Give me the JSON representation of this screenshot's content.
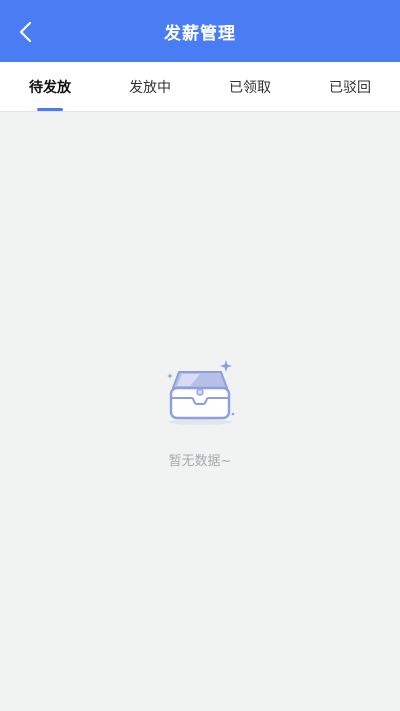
{
  "header": {
    "title": "发薪管理",
    "back_icon": "chevron-left-icon",
    "background": "#4a7df3"
  },
  "tabs": [
    {
      "label": "待发放",
      "active": true
    },
    {
      "label": "发放中",
      "active": false
    },
    {
      "label": "已领取",
      "active": false
    },
    {
      "label": "已驳回",
      "active": false
    }
  ],
  "empty_state": {
    "icon": "empty-inbox-icon",
    "text": "暂无数据~"
  },
  "colors": {
    "accent": "#4a7df3",
    "page_background": "#f1f2f2",
    "muted_text": "#a7a9ad"
  }
}
